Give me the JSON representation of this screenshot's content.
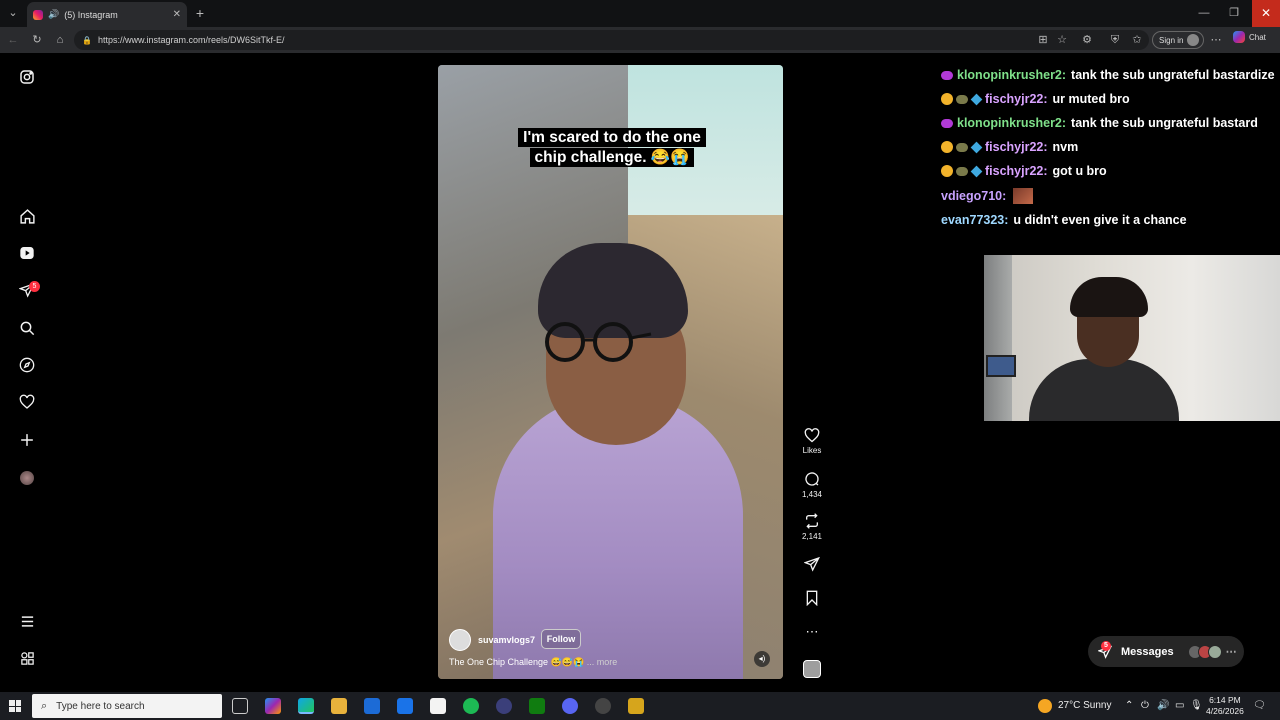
{
  "browser": {
    "tab_title": "(5) Instagram",
    "url": "https://www.instagram.com/reels/DW6SitTkf-E/",
    "sign_in_label": "Sign in",
    "chat_label": "Chat"
  },
  "sidebar": {
    "notification_count": "5"
  },
  "reel": {
    "caption_line1": "I'm scared to do the one",
    "caption_line2": "chip challenge. 😂😭",
    "username": "suvamvlogs7",
    "follow_label": "Follow",
    "description": "The One Chip Challenge 😅😅😭",
    "more_label": "... more"
  },
  "actions": {
    "likes_label": "Likes",
    "comments_count": "1,434",
    "reposts_count": "2,141"
  },
  "chat_overlay": [
    {
      "emotes": "purple",
      "name": "klonopinkrusher2:",
      "name_color": "#7fe08a",
      "message": "tank the sub ungrateful bastardize"
    },
    {
      "emotes": "gold-turtle-cube",
      "name": "fischyjr22:",
      "name_color": "#d9a3ff",
      "message": "ur muted bro"
    },
    {
      "emotes": "purple",
      "name": "klonopinkrusher2:",
      "name_color": "#7fe08a",
      "message": "tank the sub ungrateful bastard"
    },
    {
      "emotes": "gold-turtle-cube",
      "name": "fischyjr22:",
      "name_color": "#d9a3ff",
      "message": "nvm"
    },
    {
      "emotes": "gold-turtle-cube",
      "name": "fischyjr22:",
      "name_color": "#d9a3ff",
      "message": "got u bro"
    },
    {
      "emotes": "",
      "name": "vdiego710:",
      "name_color": "#c8a2ff",
      "message": ""
    },
    {
      "emotes": "",
      "name": "evan77323:",
      "name_color": "#9fd8ff",
      "message": "u didn't even give it a chance"
    }
  ],
  "messages_pill": {
    "label": "Messages",
    "count": "5"
  },
  "taskbar": {
    "search_placeholder": "Type here to search",
    "weather": "27°C  Sunny",
    "time": "6:14 PM",
    "date": "4/26/2026"
  },
  "colors": {
    "notification_red": "#ff3040",
    "close_red": "#c42b1c"
  }
}
